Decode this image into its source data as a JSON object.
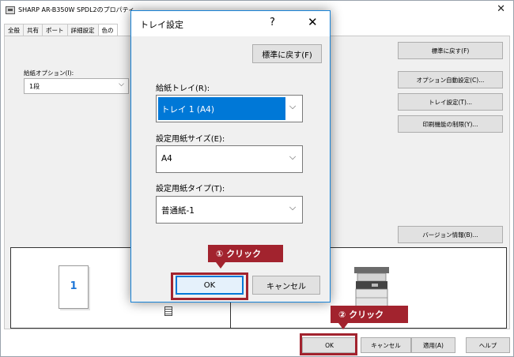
{
  "window": {
    "title": "SHARP AR-B350W SPDL2のプロパティ",
    "close_glyph": "✕"
  },
  "tabs": [
    "全般",
    "共有",
    "ポート",
    "詳細設定",
    "色の"
  ],
  "feed": {
    "label": "給紙オプション(I):",
    "value": "1段",
    "chevron": "⌵"
  },
  "side_buttons": {
    "restore": "標準に戻す(F)",
    "auto_options": "オプション自動設定(C)...",
    "tray_settings": "トレイ設定(T)...",
    "print_restrict": "印刷機能の制限(Y)...",
    "version": "バージョン情報(B)..."
  },
  "preview": {
    "tray_number": "1"
  },
  "bottom_buttons": {
    "ok": "OK",
    "cancel": "キャンセル",
    "apply": "適用(A)",
    "help": "ヘルプ"
  },
  "dialog": {
    "title": "トレイ設定",
    "help_glyph": "?",
    "close_glyph": "✕",
    "restore_label": "標準に戻す(F)",
    "feed_tray": {
      "label": "給紙トレイ(R):",
      "value": "トレイ 1 (A4)"
    },
    "paper_size": {
      "label": "設定用紙サイズ(E):",
      "value": "A4"
    },
    "paper_type": {
      "label": "設定用紙タイプ(T):",
      "value": "普通紙-1"
    },
    "chevron": "⌵",
    "ok_label": "OK",
    "cancel_label": "キャンセル"
  },
  "annotations": {
    "step1": "① クリック",
    "step2": "② クリック",
    "color": "#a2232e"
  }
}
